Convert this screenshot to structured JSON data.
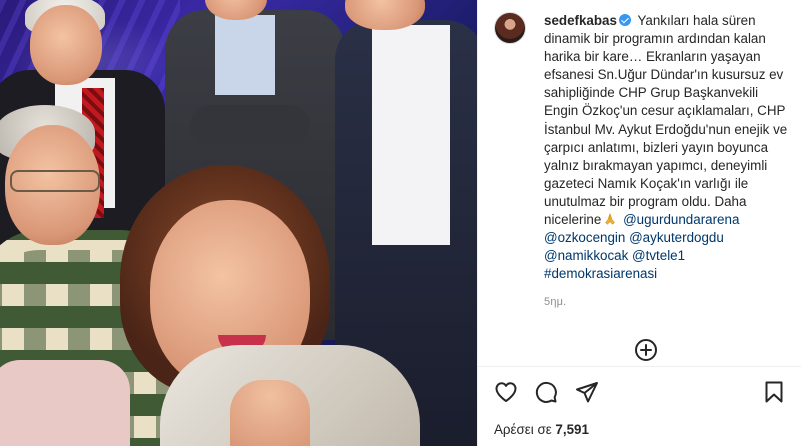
{
  "post": {
    "username": "sedefkabas",
    "caption_text": "Yankıları hala süren dinamik bir programın ardından kalan harika bir kare… Ekranların yaşayan efsanesi Sn.Uğur Dündar'ın kusursuz ev sahipliğinde CHP Grup Başkanvekili Engin Özkoç'un cesur açıklamaları, CHP İstanbul Mv. Aykut Erdoğdu'nun enejik ve çarpıcı anlatımı, bizleri yayın boyunca yalnız bırakmayan yapımcı, deneyimli gazeteci Namık Koçak'ın varlığı ile unutulmaz bir program oldu. Daha nicelerine",
    "mentions": [
      "@ugurdundararena",
      "@ozkocengin",
      "@aykuterdogdu",
      "@namikkocak",
      "@tvtele1"
    ],
    "hashtag": "#demokrasiarenasi",
    "timestamp": "5ημ.",
    "likes_label": "Αρέσει σε",
    "likes_count": "7,591"
  },
  "icons": {
    "verified": "verified-badge-icon",
    "emoji": "folded-hands-emoji",
    "load_more": "plus-circle-icon",
    "like": "heart-icon",
    "comment": "comment-bubble-icon",
    "share": "paper-plane-icon",
    "save": "bookmark-icon"
  },
  "colors": {
    "text": "#262626",
    "link": "#00376b",
    "secondary": "#8e8e8e",
    "verified": "#3897f0",
    "divider": "#efefef"
  }
}
